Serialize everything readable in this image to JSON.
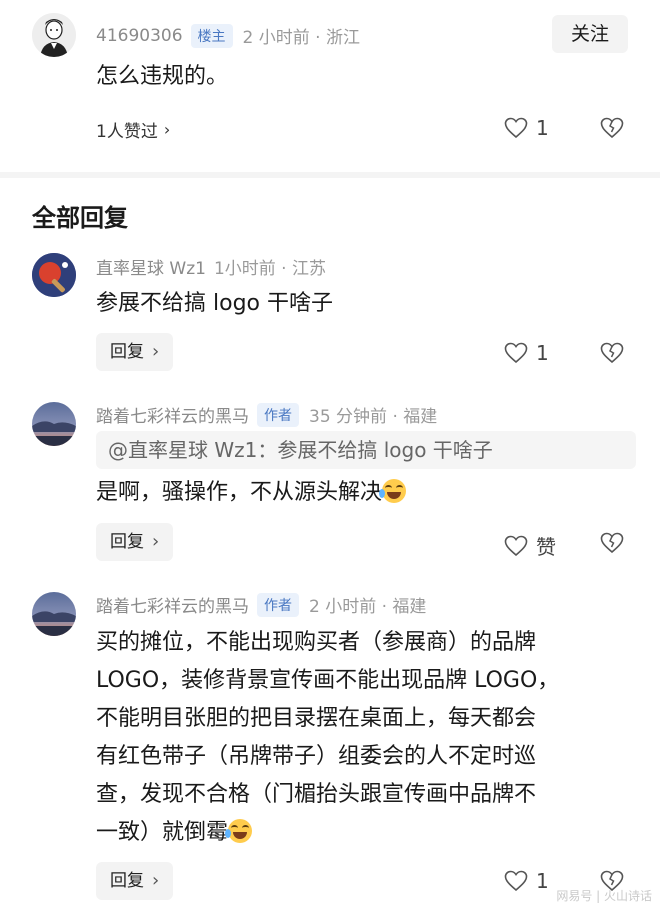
{
  "main_comment": {
    "username": "41690306",
    "tag": "楼主",
    "time_location": "2 小时前 · 浙江",
    "follow_label": "关注",
    "text": "怎么违规的。",
    "liked_by": "1人赞过",
    "like_count": "1"
  },
  "section_title": "全部回复",
  "replies": [
    {
      "username": "直率星球 Wz1",
      "time_location": "1小时前 · 江苏",
      "text": "参展不给搞 logo 干啥子",
      "reply_label": "回复",
      "like_count": "1"
    },
    {
      "username": "踏着七彩祥云的黑马",
      "tag": "作者",
      "time_location": "35 分钟前 · 福建",
      "quote": "@直率星球 Wz1：参展不给搞 logo 干啥子",
      "text": "是啊，骚操作，不从源头解决",
      "reply_label": "回复",
      "like_label": "赞"
    },
    {
      "username": "踏着七彩祥云的黑马",
      "tag": "作者",
      "time_location": "2 小时前 · 福建",
      "text_lines": [
        "买的摊位，不能出现购买者（参展商）的品牌",
        "LOGO，装修背景宣传画不能出现品牌 LOGO，",
        "不能明目张胆的把目录摆在桌面上，每天都会",
        "有红色带子（吊牌带子）组委会的人不定时巡",
        "查，发现不合格（门楣抬头跟宣传画中品牌不",
        "一致）就倒霉"
      ],
      "reply_label": "回复",
      "like_count": "1"
    }
  ],
  "watermark": "网易号 | 火山诗话",
  "colors": {
    "tag_text": "#4a78c2",
    "tag_bg": "#eaf1fb",
    "meta_gray": "#9a9a9a",
    "button_bg": "#f3f3f3"
  }
}
